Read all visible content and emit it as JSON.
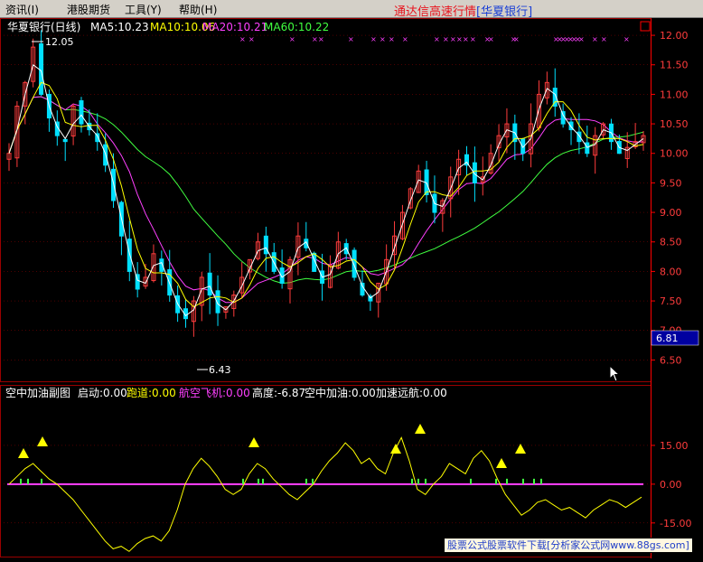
{
  "menu": [
    {
      "label": "资讯(I)",
      "name": "menu-news"
    },
    {
      "label": "港股期货",
      "name": "menu-hk-futures"
    },
    {
      "label": "工具(Y)",
      "name": "menu-tools"
    },
    {
      "label": "帮助(H)",
      "name": "menu-help"
    }
  ],
  "app_title": {
    "main": "通达信高速行情",
    "broker": "[华夏银行]"
  },
  "main_chart": {
    "stock_label": "华夏银行(日线)",
    "ma5": "MA5:10.23",
    "ma10": "MA10:10.06",
    "ma20": "MA20:10.21",
    "ma60": "MA60:10.22",
    "high_marker": "12.05",
    "low_marker": "6.43",
    "current_price": "6.81",
    "y_ticks": [
      "12.00",
      "11.50",
      "11.00",
      "10.50",
      "10.00",
      "9.50",
      "9.00",
      "8.50",
      "8.00",
      "7.50",
      "7.00",
      "6.50"
    ],
    "ylim": [
      6.2,
      12.2
    ]
  },
  "indicator": {
    "name": "空中加油副图",
    "start_label": "启动:0.00",
    "runway_label": "跑道:0.00",
    "airplane_label": "航空飞机:0.00",
    "height_label": "高度:-6.87",
    "refuel_label": "空中加油:0.00",
    "accel_label": "加速远航:0.00",
    "y_ticks": [
      "15.00",
      "0.00",
      "-15.00"
    ],
    "ylim": [
      -28,
      30
    ]
  },
  "watermark": {
    "text": "股票公式股票软件下载[分析家公式网",
    "url": "www.88gs.com]"
  },
  "colors": {
    "up": "#ff3c3c",
    "down": "#00e0ff",
    "ma5": "#ffffff",
    "ma10": "#ffff00",
    "ma20": "#ff40ff",
    "ma60": "#40ff40",
    "grid": "#9a0000",
    "axis": "#ff0000"
  },
  "chart_data": {
    "type": "candlestick",
    "ma_series_names": [
      "MA5",
      "MA10",
      "MA20",
      "MA60"
    ],
    "approx_close_path": [
      10.0,
      10.8,
      11.2,
      11.8,
      11.0,
      10.6,
      10.3,
      10.2,
      10.8,
      10.5,
      10.4,
      10.2,
      9.8,
      9.2,
      8.6,
      8.0,
      7.7,
      7.9,
      8.3,
      8.0,
      7.6,
      7.3,
      7.2,
      7.5,
      7.9,
      7.6,
      7.3,
      7.4,
      7.6,
      7.9,
      8.2,
      8.5,
      8.3,
      8.0,
      7.8,
      8.2,
      8.6,
      8.4,
      8.0,
      7.8,
      8.1,
      8.5,
      8.3,
      7.9,
      7.6,
      7.5,
      7.8,
      8.2,
      8.6,
      9.0,
      9.4,
      9.7,
      9.3,
      9.0,
      9.2,
      9.6,
      9.9,
      9.8,
      9.5,
      9.6,
      10.0,
      10.3,
      10.5,
      10.2,
      10.0,
      10.5,
      11.0,
      11.2,
      10.8,
      10.5,
      10.4,
      10.2,
      10.0,
      10.3,
      10.5,
      10.2,
      10.0,
      10.1,
      10.2,
      10.3
    ],
    "indicator_height_path": [
      0,
      3,
      6,
      8,
      5,
      2,
      0,
      -3,
      -6,
      -10,
      -14,
      -18,
      -22,
      -25,
      -24,
      -26,
      -23,
      -21,
      -20,
      -22,
      -18,
      -10,
      0,
      6,
      10,
      7,
      3,
      -2,
      -4,
      -2,
      4,
      8,
      6,
      2,
      -1,
      -4,
      -6,
      -3,
      0,
      5,
      9,
      12,
      16,
      13,
      8,
      10,
      6,
      4,
      12,
      18,
      9,
      -2,
      -4,
      0,
      3,
      8,
      6,
      4,
      10,
      13,
      9,
      2,
      -4,
      -8,
      -12,
      -10,
      -7,
      -6,
      -8,
      -10,
      -9,
      -11,
      -13,
      -10,
      -8,
      -6,
      -7,
      -9,
      -7,
      -5
    ]
  }
}
